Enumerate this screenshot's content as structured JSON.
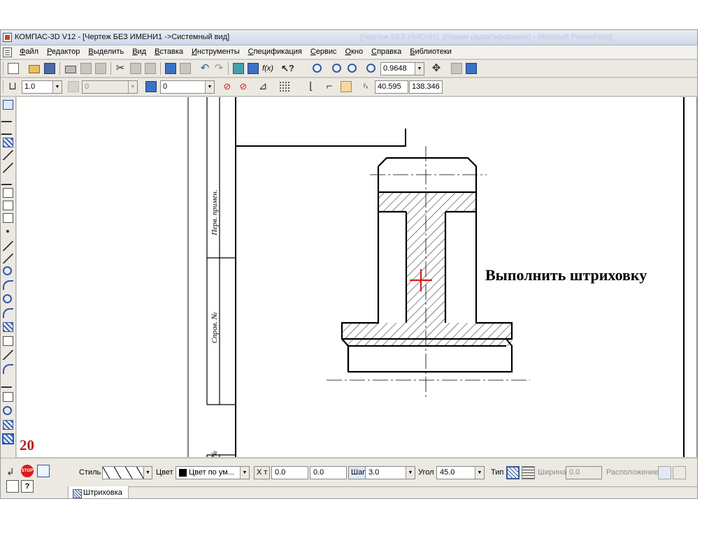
{
  "window": {
    "title": "КОМПАС-3D V12 - [Чертеж БЕЗ ИМЕНИ1 ->Системный вид]",
    "background_title": "[Чертеж БЕЗ ИМЕНИ1 (Режим редактирования) - Microsoft PowerPoint]"
  },
  "menu": [
    "Файл",
    "Редактор",
    "Выделить",
    "Вид",
    "Вставка",
    "Инструменты",
    "Спецификация",
    "Сервис",
    "Окно",
    "Справка",
    "Библиотеки"
  ],
  "toolbar": {
    "zoom": "0.9648",
    "line_scale": "1.0",
    "layer_step": "0",
    "view_number": "0",
    "coord_x": "40.595",
    "coord_y": "138.346"
  },
  "canvas": {
    "annotation": "Выполнить штриховку",
    "stamp_labels": [
      "Перв. примен.",
      "Справ. №",
      "Инв. №"
    ]
  },
  "slide_number": "20",
  "property_bar": {
    "style_label": "Стиль",
    "color_label": "Цвет",
    "color_value": "Цвет по ум...",
    "x_label": "X т",
    "x_value": "0.0",
    "y_value": "0.0",
    "step_label": "Шаг",
    "step_value": "3.0",
    "angle_label": "Угол",
    "angle_value": "45.0",
    "type_label": "Тип",
    "width_label": "Ширина",
    "width_value": "0.0",
    "placement_label": "Расположение",
    "tab_label": "Штриховка",
    "stop_label": "STOP"
  },
  "colors": {
    "accent_red": "#d81e1e",
    "slide_number": "#b81e1e",
    "toolbar_bg": "#ece9e2"
  }
}
